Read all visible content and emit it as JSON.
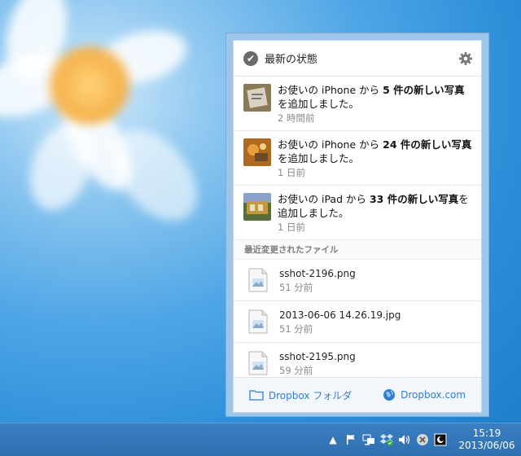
{
  "popup": {
    "header": {
      "title": "最新の状態",
      "status_icon": "check-circle-icon",
      "settings_icon": "gear-icon"
    },
    "notifications": [
      {
        "prefix": "お使いの iPhone から ",
        "bold": "5 件の新しい写真",
        "suffix": "を追加しました。",
        "time": "2 時間前",
        "thumb_color": "#8a7a55"
      },
      {
        "prefix": "お使いの iPhone から ",
        "bold": "24 件の新しい写真",
        "suffix": "を追加しました。",
        "time": "1 日前",
        "thumb_color": "#b06a20"
      },
      {
        "prefix": "お使いの iPad から ",
        "bold": "33 件の新しい写真",
        "suffix": "を追加しました。",
        "time": "1 日前",
        "thumb_color": "#5a6e3a"
      }
    ],
    "recent_files_label": "最近変更されたファイル",
    "files": [
      {
        "name": "sshot-2196.png",
        "time": "51 分前"
      },
      {
        "name": "2013-06-06 14.26.19.jpg",
        "time": "51 分前"
      },
      {
        "name": "sshot-2195.png",
        "time": "59 分前"
      }
    ],
    "footer": {
      "folder_label": "Dropbox フォルダ",
      "web_label": "Dropbox.com"
    }
  },
  "taskbar": {
    "clock_time": "15:19",
    "clock_date": "2013/06/06",
    "tray_icons": [
      "show-hidden-icons-arrow",
      "flag-icon",
      "network-icon",
      "dropbox-icon",
      "volume-icon",
      "close-circle-icon",
      "app-icon"
    ]
  },
  "colors": {
    "link": "#2f7fd1",
    "taskbar": "#3277bb",
    "popup_border": "#9ec5ea"
  }
}
